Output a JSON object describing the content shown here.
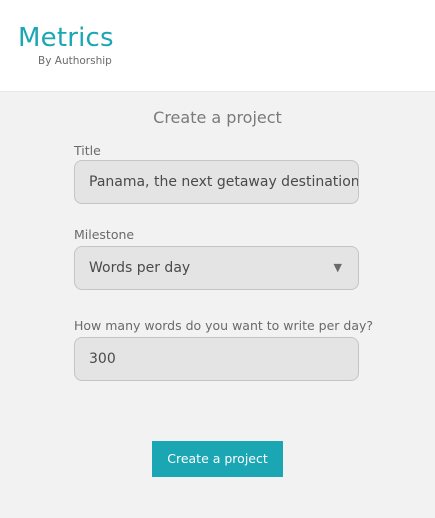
{
  "brand": {
    "name": "Metrics",
    "tagline": "By Authorship",
    "color": "#1ba6b4"
  },
  "form": {
    "heading": "Create a project",
    "title_label": "Title",
    "title_value": "Panama, the next getaway destination",
    "milestone_label": "Milestone",
    "milestone_value": "Words per day",
    "milestone_icon": "dropdown-triangle-icon",
    "words_label": "How many words do you want to write per day?",
    "words_value": "300",
    "submit_label": "Create a project"
  }
}
